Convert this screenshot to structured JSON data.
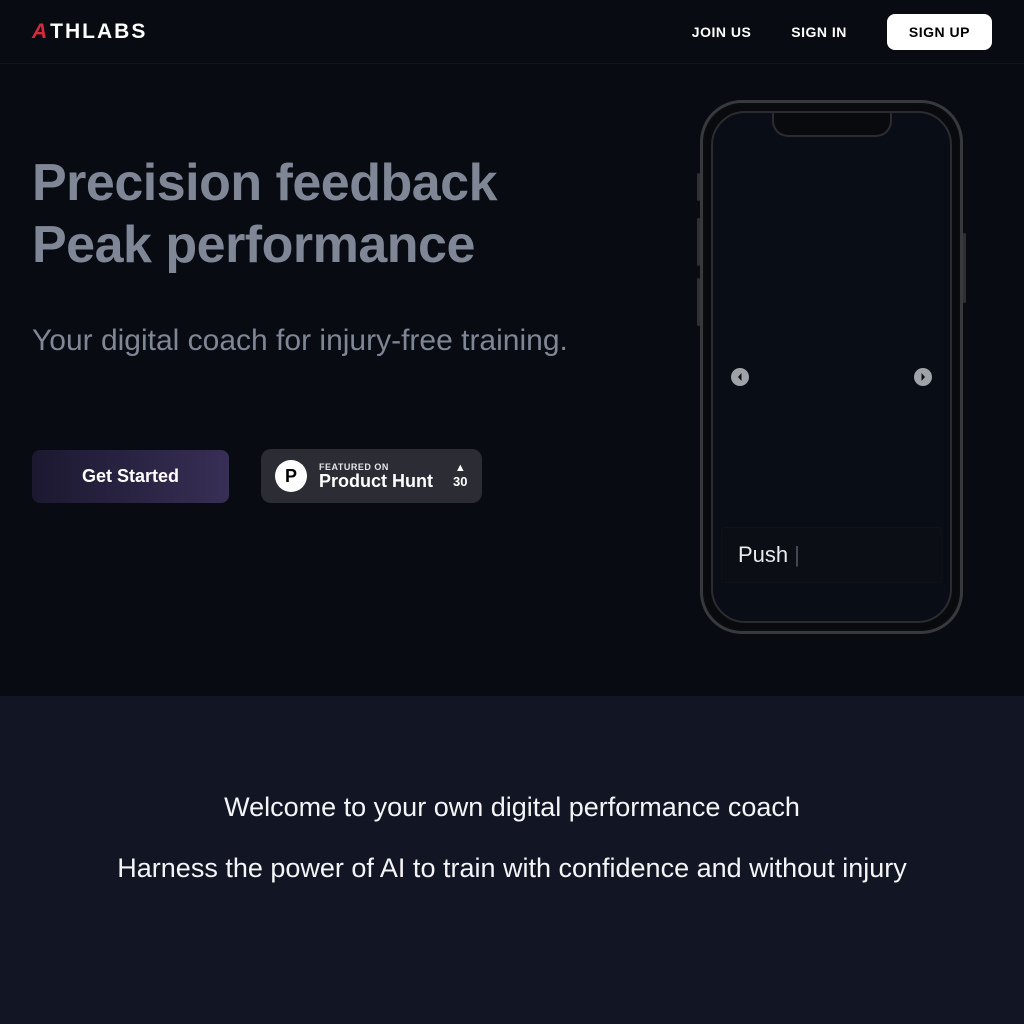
{
  "brand": {
    "mark": "A",
    "name": "THLABS"
  },
  "nav": {
    "join": "JOIN US",
    "signin": "SIGN IN",
    "signup": "SIGN UP"
  },
  "hero": {
    "title_line1": "Precision feedback",
    "title_line2": "Peak performance",
    "subtitle": "Your digital coach for injury-free training.",
    "cta": "Get Started",
    "ph_featured": "FEATURED ON",
    "ph_name": "Product Hunt",
    "ph_votes": "30",
    "phone_label": "Push"
  },
  "section2": {
    "line1": "Welcome to your own digital performance coach",
    "line2": "Harness the power of AI to train with confidence and without injury"
  },
  "colors": {
    "accent_red": "#d62a3c",
    "bg_dark": "#080b12",
    "bg_panel": "#111524"
  }
}
